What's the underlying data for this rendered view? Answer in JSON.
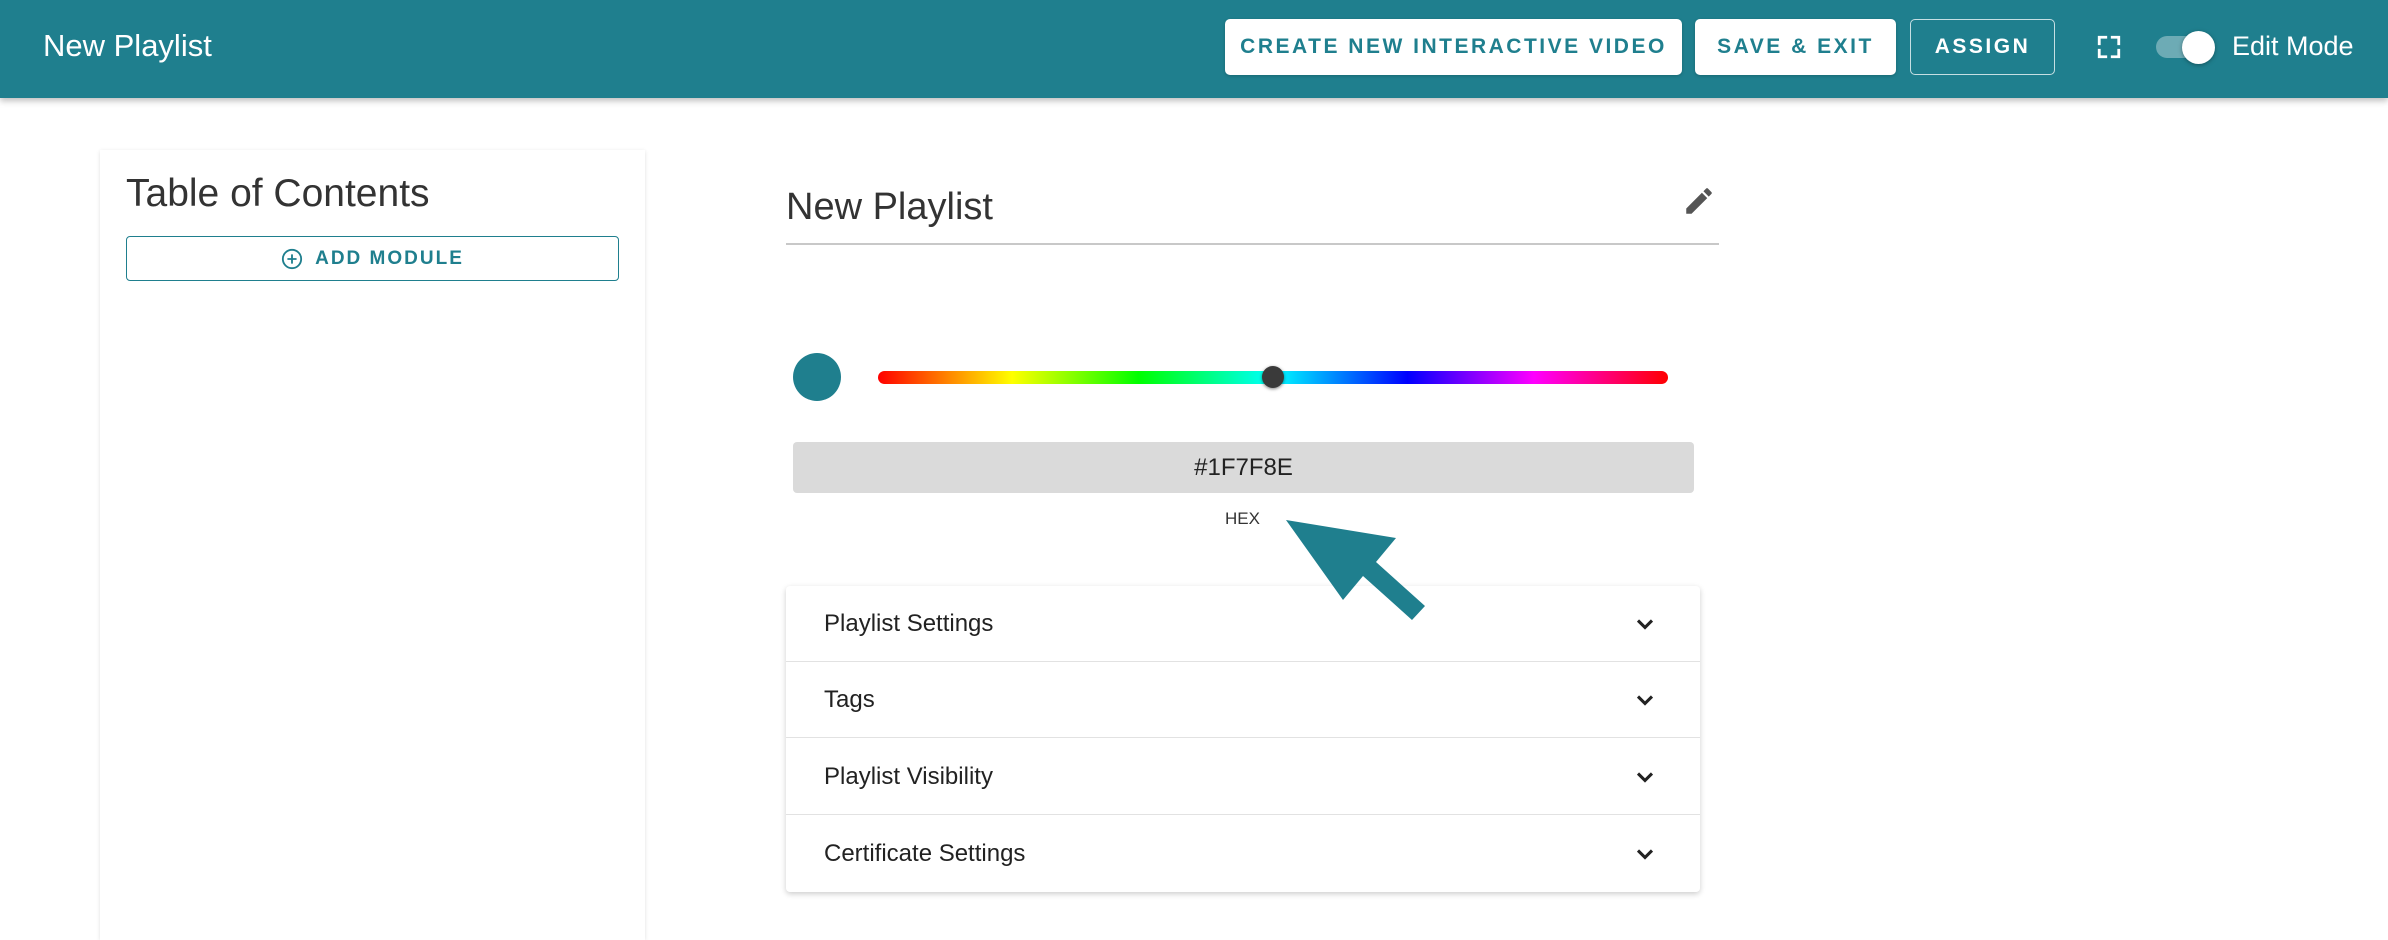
{
  "app": {
    "title": "New Playlist",
    "accent_color": "#1F7F8E"
  },
  "toolbar": {
    "create_video_label": "CREATE NEW INTERACTIVE VIDEO",
    "save_exit_label": "SAVE & EXIT",
    "assign_label": "ASSIGN",
    "fullscreen_icon": "fullscreen-icon",
    "edit_mode_label": "Edit Mode",
    "edit_mode_on": true
  },
  "toc": {
    "title": "Table of Contents",
    "add_module_label": "ADD MODULE",
    "add_module_icon": "plus-circle-icon"
  },
  "playlist": {
    "name": "New Playlist",
    "edit_icon": "pencil-icon"
  },
  "color_picker": {
    "swatch_color": "#1F7F8E",
    "hue_position": 0.5,
    "hex_value": "#1F7F8E",
    "hex_label": "HEX"
  },
  "accordion": {
    "items": [
      {
        "label": "Playlist Settings"
      },
      {
        "label": "Tags"
      },
      {
        "label": "Playlist Visibility"
      },
      {
        "label": "Certificate Settings"
      }
    ],
    "chevron_icon": "chevron-down-icon"
  }
}
